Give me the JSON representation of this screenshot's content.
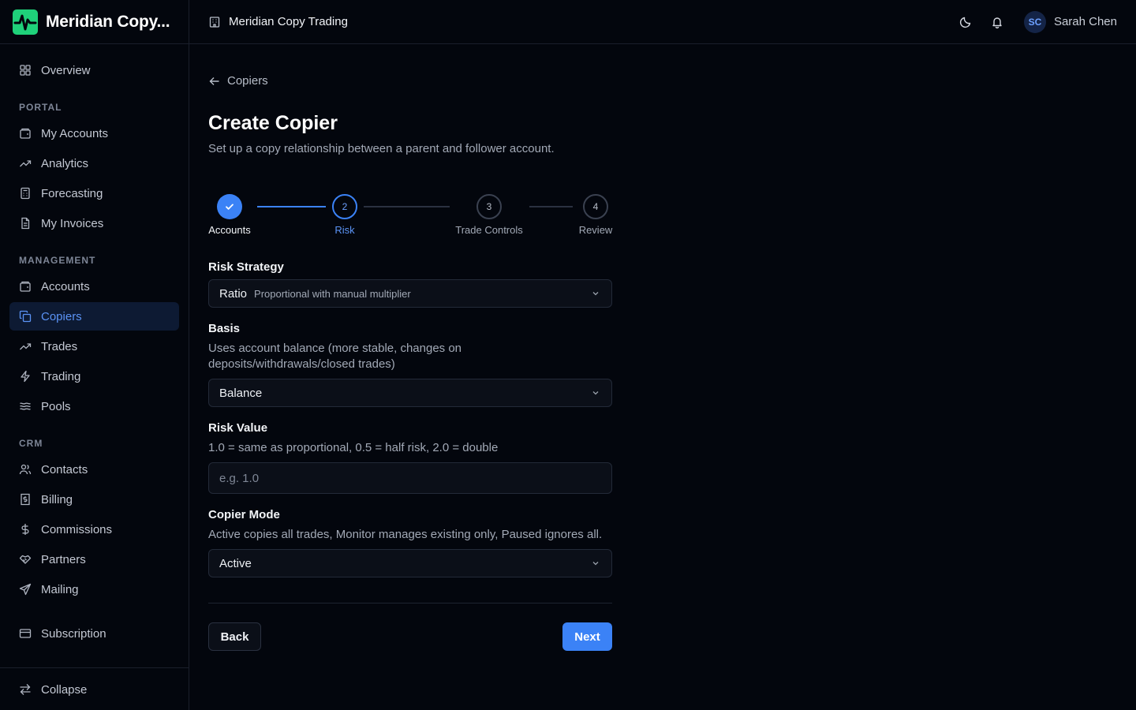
{
  "app": {
    "brand_name": "Meridian Copy...",
    "workspace_title": "Meridian Copy Trading"
  },
  "user": {
    "initials": "SC",
    "name": "Sarah Chen"
  },
  "sidebar": {
    "overview": "Overview",
    "sections": {
      "portal": "PORTAL",
      "management": "MANAGEMENT",
      "crm": "CRM"
    },
    "portal_items": [
      "My Accounts",
      "Analytics",
      "Forecasting",
      "My Invoices"
    ],
    "management_items": [
      "Accounts",
      "Copiers",
      "Trades",
      "Trading",
      "Pools"
    ],
    "crm_items": [
      "Contacts",
      "Billing",
      "Commissions",
      "Partners",
      "Mailing"
    ],
    "subscription": "Subscription",
    "collapse": "Collapse",
    "active_item": "Copiers"
  },
  "page": {
    "back_link": "Copiers",
    "title": "Create Copier",
    "subtitle": "Set up a copy relationship between a parent and follower account."
  },
  "stepper": {
    "current_step": 2,
    "steps": [
      {
        "number": "1",
        "label": "Accounts",
        "status": "complete"
      },
      {
        "number": "2",
        "label": "Risk",
        "status": "current"
      },
      {
        "number": "3",
        "label": "Trade Controls",
        "status": "upcoming"
      },
      {
        "number": "4",
        "label": "Review",
        "status": "upcoming"
      }
    ]
  },
  "form": {
    "risk_strategy": {
      "label": "Risk Strategy",
      "value": "Ratio",
      "description": "Proportional with manual multiplier"
    },
    "basis": {
      "label": "Basis",
      "help": "Uses account balance (more stable, changes on deposits/withdrawals/closed trades)",
      "value": "Balance"
    },
    "risk_value": {
      "label": "Risk Value",
      "help": "1.0 = same as proportional, 0.5 = half risk, 2.0 = double",
      "placeholder": "e.g. 1.0",
      "value": ""
    },
    "copier_mode": {
      "label": "Copier Mode",
      "help": "Active copies all trades, Monitor manages existing only, Paused ignores all.",
      "value": "Active"
    }
  },
  "actions": {
    "back": "Back",
    "next": "Next"
  },
  "colors": {
    "background": "#03060d",
    "accent": "#3b82f6",
    "active_nav_bg": "#0d1a33",
    "brand_green": "#22c55e"
  }
}
